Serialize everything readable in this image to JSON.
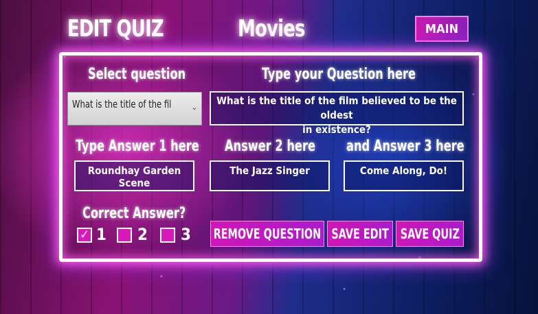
{
  "header": {
    "edit_title": "EDIT QUIZ",
    "category": "Movies",
    "main_button": "MAIN"
  },
  "labels": {
    "select_question": "Select question",
    "type_question": "Type your Question here",
    "answer1": "Type Answer 1 here",
    "answer2": "Answer 2 here",
    "answer3": "and Answer 3 here",
    "correct_answer": "Correct Answer?"
  },
  "select": {
    "selected": "What is the title of the film"
  },
  "question": {
    "line1": "What is the title of the film believed to be the oldest",
    "line2": "in existence?"
  },
  "answers": {
    "a1": "Roundhay Garden Scene",
    "a2": "The Jazz Singer",
    "a3": "Come Along, Do!"
  },
  "correct": {
    "options": [
      "1",
      "2",
      "3"
    ],
    "selected": "1",
    "check_mark": "✓"
  },
  "actions": {
    "remove": "REMOVE QUESTION",
    "save_edit": "SAVE EDIT",
    "save_quiz": "SAVE QUIZ"
  },
  "colors": {
    "accent": "#d81ab8",
    "panel_glow": "#ff5ae6",
    "blue": "#1f2d8c"
  }
}
